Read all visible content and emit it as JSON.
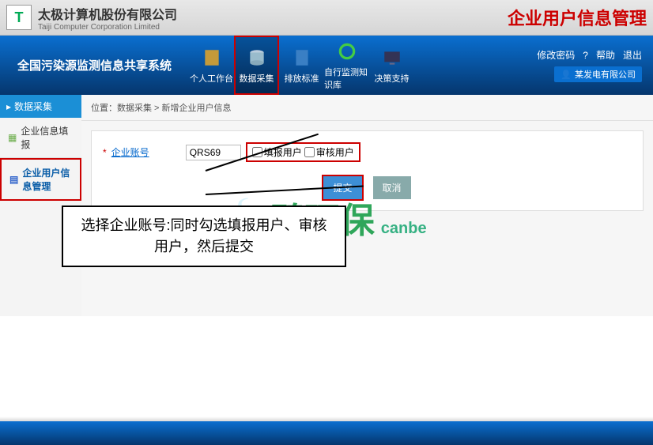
{
  "company": {
    "cn": "太极计算机股份有限公司",
    "en": "Taiji Computer Corporation Limited"
  },
  "page_label": "企业用户信息管理",
  "system_title": "全国污染源监测信息共享系统",
  "nav": [
    {
      "label": "个人工作台"
    },
    {
      "label": "数据采集"
    },
    {
      "label": "排放标准"
    },
    {
      "label": "自行监测知识库"
    },
    {
      "label": "决策支持"
    }
  ],
  "nav_right": {
    "change_pw": "修改密码",
    "help": "帮助",
    "logout": "退出",
    "user": "某发电有限公司"
  },
  "sidebar": {
    "head": "数据采集",
    "items": [
      "企业信息填报",
      "企业用户信息管理"
    ]
  },
  "breadcrumb": "位置：数据采集 > 新增企业用户信息",
  "form": {
    "account_label": "企业账号",
    "account_value": "QRS69",
    "chk1": "填报用户",
    "chk2": "审核用户",
    "submit": "提交",
    "cancel": "取消"
  },
  "callout": "选择企业账号:同时勾选填报用户、审核用户，然后提交",
  "watermark": {
    "main": "碧环保",
    "sub": "canbe"
  }
}
